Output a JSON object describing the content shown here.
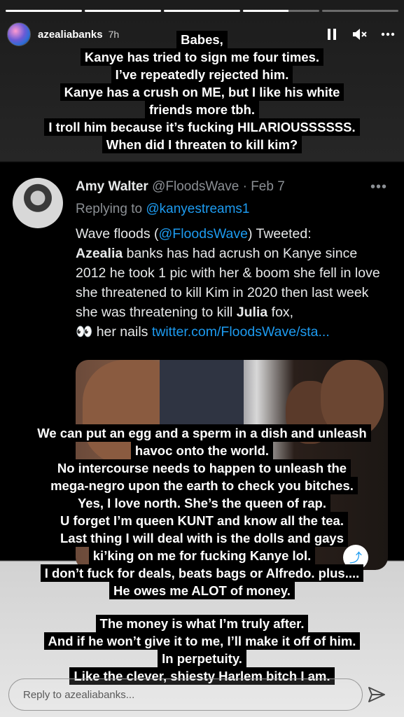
{
  "story": {
    "segments": [
      {
        "progress": 1.0
      },
      {
        "progress": 1.0
      },
      {
        "progress": 1.0
      },
      {
        "progress": 0.6
      },
      {
        "progress": 0.0
      }
    ]
  },
  "header": {
    "username": "azealiabanks",
    "time": "7h",
    "pause_icon": "pause-icon",
    "mute_icon": "mute-icon",
    "more_icon": "more-icon"
  },
  "caption_top": [
    "Babes,",
    "Kanye has tried to sign me four times.",
    "I’ve repeatedly rejected him.",
    "Kanye has a crush on ME, but I like his white",
    "friends more tbh.",
    "I troll him because it’s fucking HILARIOUSSSSSS.",
    "When did I threaten to kill kim?"
  ],
  "tweet": {
    "name": "Amy Walter",
    "handle": "@FloodsWave",
    "separator": " · ",
    "date": "Feb 7",
    "more": "•••",
    "replying_prefix": "Replying to ",
    "replying_to": "@kanyestreams1",
    "body_1": "Wave floods (",
    "body_mention": "@FloodsWave",
    "body_2": ") Tweeted:",
    "body_3": "Azealia",
    "body_4": " banks has had acrush on Kanye since 2012 he took 1 pic with her & boom she fell in love she threatened to kill Kim in 2020 then last week she was threatening to kill ",
    "body_5": "Julia",
    "body_6": " fox,",
    "body_eyes": "👀",
    "body_7": " her nails  ",
    "body_link": "twitter.com/FloodsWave/sta..."
  },
  "caption_bottom": [
    "We can put an egg and a sperm in a dish and unleash",
    "havoc onto the world.",
    "No intercourse needs to happen to unleash the",
    "mega-negro upon the earth to check you bitches.",
    "Yes, I love north. She’s  the queen of rap.",
    "U forget I’m queen KUNT and know all the tea.",
    "Last thing I will deal with is the dolls and gays",
    "ki’king on me for fucking Kanye lol.",
    "I don’t fuck for deals, beats bags or Alfredo. plus....",
    "He owes me ALOT of money.",
    "",
    "The money is what I’m truly after.",
    "And if he won’t give it to me, I’ll make it off of him.",
    "In perpetuity.",
    "Like the clever, shiesty Harlem bitch I am."
  ],
  "reply": {
    "placeholder": "Reply to azealiabanks..."
  }
}
